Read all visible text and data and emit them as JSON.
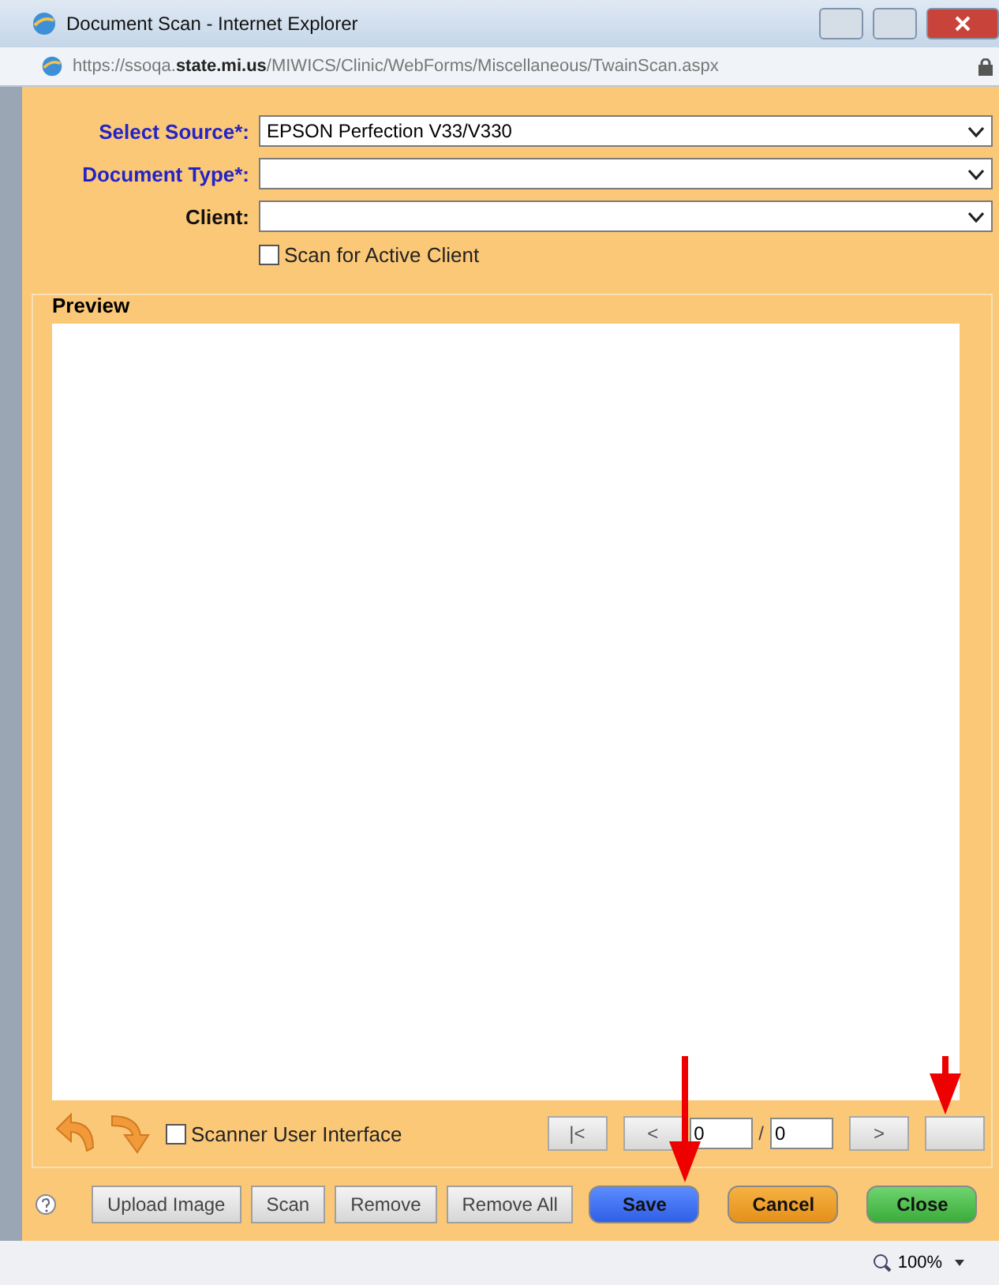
{
  "window": {
    "title": "Document Scan - Internet Explorer"
  },
  "address_bar": {
    "url": "https://ssoqa.**state.mi.us**/MIWICS/Clinic/WebForms/Miscellaneous/TwainScan.aspx"
  },
  "fields": [
    {
      "label": "Select Source*:",
      "required": true,
      "value": "EPSON Perfection V33/V330"
    },
    {
      "label": "Document Type*:",
      "required": true
    },
    {
      "label": "Client:",
      "required": false
    }
  ],
  "scan_for_active_client": {
    "label": "Scan for Active Client",
    "checked": false
  },
  "preview": {
    "title": "Preview"
  },
  "scanner_user_interface": {
    "label": "Scanner User Interface",
    "checked": false
  },
  "pager": {
    "first": "|<",
    "prev": "<",
    "page": "0",
    "separator": "/",
    "total": "0",
    "next": ">"
  },
  "buttons": [
    {
      "label": "Upload Image",
      "kind": "default"
    },
    {
      "label": "Scan",
      "kind": "default"
    },
    {
      "label": "Remove",
      "kind": "default"
    },
    {
      "label": "Remove All",
      "kind": "default"
    },
    {
      "label": "Save",
      "kind": "primary"
    },
    {
      "label": "Cancel",
      "kind": "warning"
    },
    {
      "label": "Close",
      "kind": "success"
    }
  ],
  "status_bar": {
    "zoom": "100%"
  }
}
